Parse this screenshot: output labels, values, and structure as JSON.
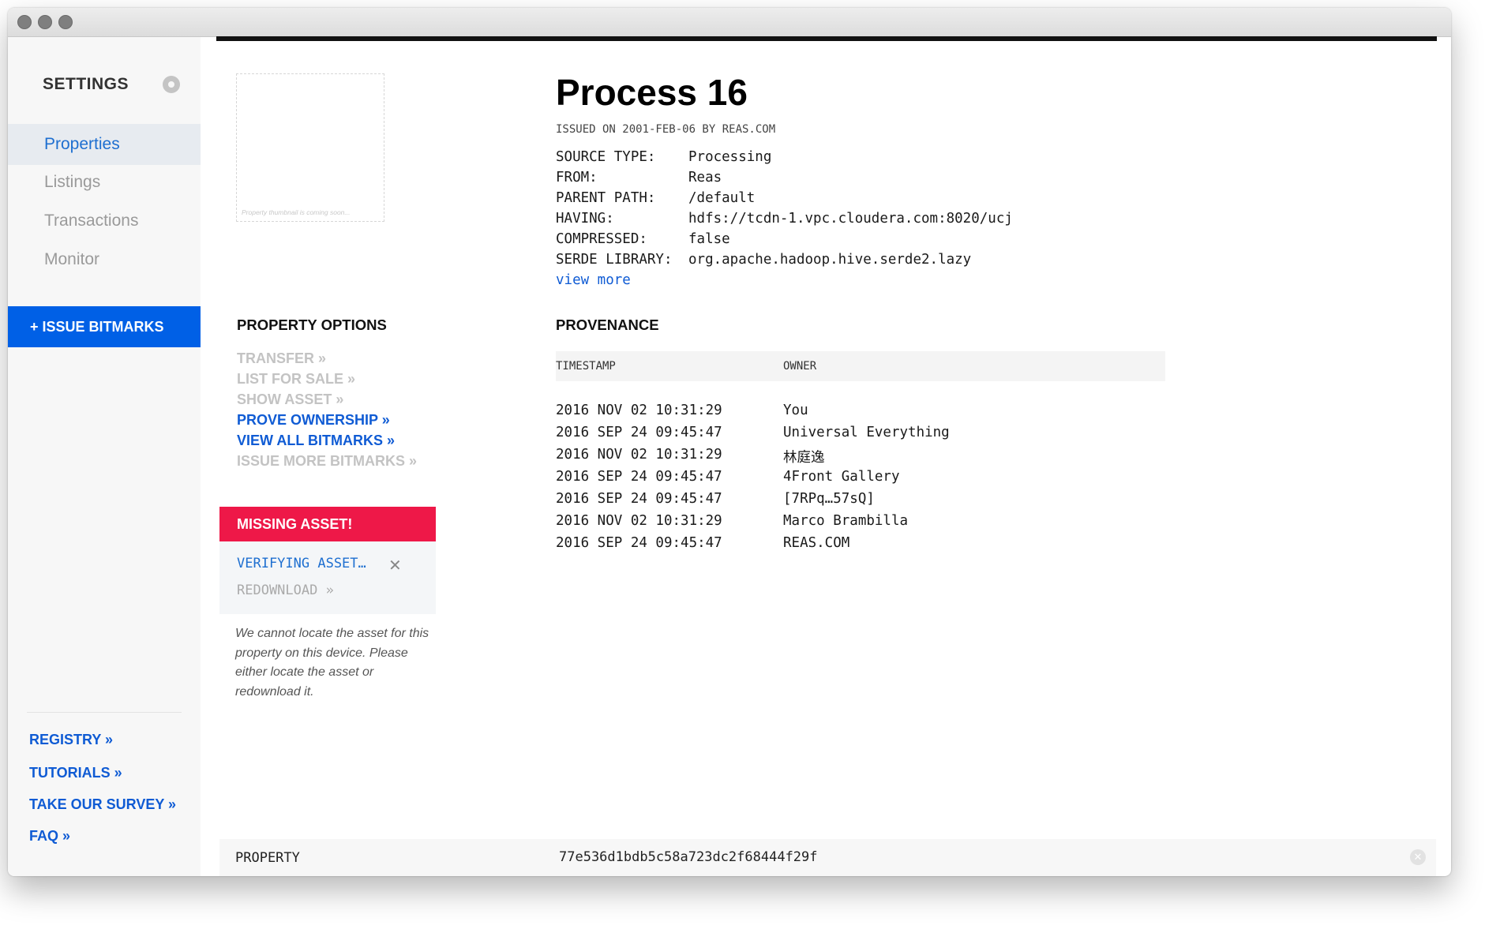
{
  "sidebar": {
    "heading": "SETTINGS",
    "items": [
      {
        "label": "Properties",
        "active": true
      },
      {
        "label": "Listings"
      },
      {
        "label": "Transactions"
      },
      {
        "label": "Monitor"
      }
    ],
    "issue_button": "+ ISSUE BITMARKS",
    "links": [
      "REGISTRY »",
      "TUTORIALS »",
      "TAKE OUR SURVEY »",
      "FAQ »"
    ]
  },
  "thumbnail": {
    "caption": "Property thumbnail is coming soon..."
  },
  "property": {
    "title": "Process 16",
    "issued": "ISSUED ON 2001-FEB-06 BY REAS.COM",
    "meta": [
      {
        "key": "SOURCE TYPE:",
        "value": "Processing"
      },
      {
        "key": "FROM:",
        "value": "Reas"
      },
      {
        "key": "PARENT PATH:",
        "value": "/default"
      },
      {
        "key": "HAVING:",
        "value": "hdfs://tcdn-1.vpc.cloudera.com:8020/ucj"
      },
      {
        "key": "COMPRESSED:",
        "value": "false"
      },
      {
        "key": "SERDE LIBRARY:",
        "value": "org.apache.hadoop.hive.serde2.lazy"
      }
    ],
    "view_more": "view more"
  },
  "options": {
    "heading": "PROPERTY OPTIONS",
    "items": [
      {
        "label": "TRANSFER »",
        "enabled": false
      },
      {
        "label": "LIST FOR SALE »",
        "enabled": false
      },
      {
        "label": "SHOW ASSET »",
        "enabled": false
      },
      {
        "label": "PROVE OWNERSHIP »",
        "enabled": true
      },
      {
        "label": "VIEW ALL BITMARKS »",
        "enabled": true
      },
      {
        "label": "ISSUE MORE BITMARKS »",
        "enabled": false
      }
    ]
  },
  "missing": {
    "title": "MISSING ASSET!",
    "verifying": "VERIFYING ASSET…",
    "close_glyph": "✕",
    "redownload": "REDOWNLOAD  »",
    "note": "We cannot locate the asset for this property on this device. Please either locate the asset or redownload it."
  },
  "provenance": {
    "heading": "PROVENANCE",
    "columns": [
      "TIMESTAMP",
      "OWNER"
    ],
    "rows": [
      {
        "timestamp": "2016 NOV 02 10:31:29",
        "owner": "You"
      },
      {
        "timestamp": "2016 SEP 24 09:45:47",
        "owner": "Universal Everything"
      },
      {
        "timestamp": "2016 NOV 02 10:31:29",
        "owner": "林庭逸"
      },
      {
        "timestamp": "2016 SEP 24 09:45:47",
        "owner": "4Front Gallery"
      },
      {
        "timestamp": "2016 SEP 24 09:45:47",
        "owner": "[7RPq…57sQ]"
      },
      {
        "timestamp": "2016 NOV 02 10:31:29",
        "owner": "Marco Brambilla"
      },
      {
        "timestamp": "2016 SEP 24 09:45:47",
        "owner": "REAS.COM"
      }
    ]
  },
  "footer": {
    "label": "PROPERTY",
    "hash": "77e536d1bdb5c58a723dc2f68444f29f",
    "close_glyph": "✕"
  },
  "colors": {
    "accent": "#0060e6",
    "link": "#0f5bd4",
    "alert": "#ee1848"
  }
}
